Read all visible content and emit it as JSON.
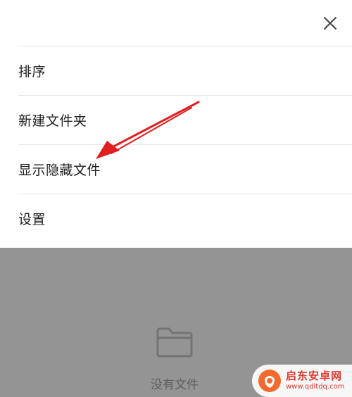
{
  "menu": {
    "items": [
      {
        "label": "排序"
      },
      {
        "label": "新建文件夹"
      },
      {
        "label": "显示隐藏文件"
      },
      {
        "label": "设置"
      }
    ]
  },
  "empty_state": {
    "text": "没有文件"
  },
  "watermark": {
    "title": "启东安卓网",
    "url": "www.qdltdq.com"
  },
  "colors": {
    "sheet_background": "#ffffff",
    "overlay_background": "#949494",
    "annotation_arrow": "#e0201f",
    "watermark_red": "#e03a2f"
  },
  "icons": {
    "close": "close-icon",
    "folder": "folder-icon",
    "annotation": "arrow-annotation"
  }
}
